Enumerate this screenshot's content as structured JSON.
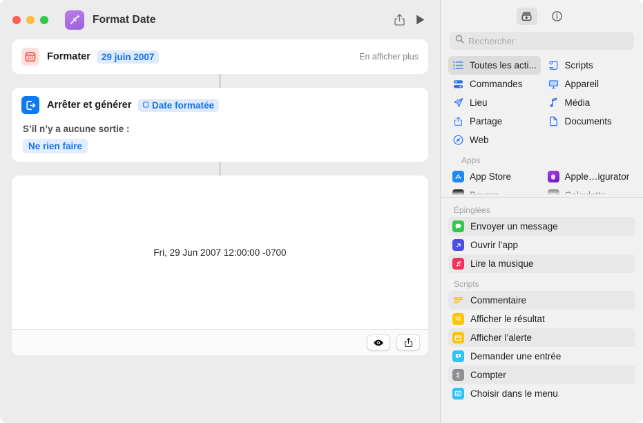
{
  "window": {
    "title": "Format Date",
    "app_icon": "shortcuts-icon",
    "traffic_lights": [
      "close",
      "minimize",
      "zoom"
    ],
    "toolbar": {
      "share_label": "share-icon",
      "run_label": "play-icon"
    }
  },
  "editor": {
    "actions": [
      {
        "icon": "calendar-icon",
        "title": "Formater",
        "token": "29 juin 2007",
        "more_label": "En afficher plus"
      },
      {
        "icon": "stop-and-output-icon",
        "title": "Arrêter et générer",
        "token": "Date formatée",
        "sub_label": "S’il n’y a aucune sortie :",
        "sub_value": "Ne rien faire"
      }
    ],
    "result": {
      "text": "Fri, 29 Jun 2007 12:00:00 -0700",
      "quicklook_label": "eye-icon",
      "share_label": "share-icon"
    }
  },
  "sidebar": {
    "top_buttons": [
      {
        "name": "action-library-icon",
        "selected": true
      },
      {
        "name": "info-icon",
        "selected": false
      }
    ],
    "search": {
      "placeholder": "Rechercher",
      "value": ""
    },
    "categories": [
      {
        "label": "Toutes les acti...",
        "icon": "list-icon",
        "color": "#3b82f6",
        "selected": true
      },
      {
        "label": "Scripts",
        "icon": "scroll-icon",
        "color": "#3b82f6",
        "selected": false
      },
      {
        "label": "Commandes",
        "icon": "sliders-icon",
        "color": "#2f6fed",
        "selected": false
      },
      {
        "label": "Appareil",
        "icon": "display-icon",
        "color": "#3b82f6",
        "selected": false
      },
      {
        "label": "Lieu",
        "icon": "paperplane-icon",
        "color": "#3b82f6",
        "selected": false
      },
      {
        "label": "Média",
        "icon": "music-note-icon",
        "color": "#2f6fed",
        "selected": false
      },
      {
        "label": "Partage",
        "icon": "share-icon",
        "color": "#3b82f6",
        "selected": false
      },
      {
        "label": "Documents",
        "icon": "document-icon",
        "color": "#3b82f6",
        "selected": false
      },
      {
        "label": "Web",
        "icon": "compass-icon",
        "color": "#3b82f6",
        "selected": false
      }
    ],
    "apps_section": {
      "header": "Apps",
      "items": [
        {
          "label": "App Store",
          "icon": "app-store-icon",
          "color": "#1e8bf5"
        },
        {
          "label": "Apple…igurator",
          "icon": "apple-configurator-icon",
          "color": "#8a2be2"
        },
        {
          "label": "Bourse",
          "icon": "stocks-icon",
          "color": "#1c1c1e"
        },
        {
          "label": "Calculette",
          "icon": "calculator-icon",
          "color": "#7a7a7e"
        }
      ]
    },
    "pinned_section": {
      "header": "Épinglées",
      "items": [
        {
          "label": "Envoyer un message",
          "icon": "messages-icon",
          "color": "#31c84c"
        },
        {
          "label": "Ouvrir l’app",
          "icon": "open-app-icon",
          "color": "#4a51e0"
        },
        {
          "label": "Lire la musique",
          "icon": "music-icon",
          "color": "#f4315b"
        }
      ]
    },
    "scripts_section": {
      "header": "Scripts",
      "items": [
        {
          "label": "Commentaire",
          "icon": "comment-lines-icon",
          "color": "#ffc409"
        },
        {
          "label": "Afficher le résultat",
          "icon": "show-result-icon",
          "color": "#ffc409"
        },
        {
          "label": "Afficher l’alerte",
          "icon": "alert-icon",
          "color": "#ffc409"
        },
        {
          "label": "Demander une entrée",
          "icon": "ask-input-icon",
          "color": "#2fc2f7"
        },
        {
          "label": "Compter",
          "icon": "sigma-icon",
          "color": "#8e8e93"
        },
        {
          "label": "Choisir dans le menu",
          "icon": "choose-menu-icon",
          "color": "#2fc2f7"
        }
      ]
    }
  }
}
